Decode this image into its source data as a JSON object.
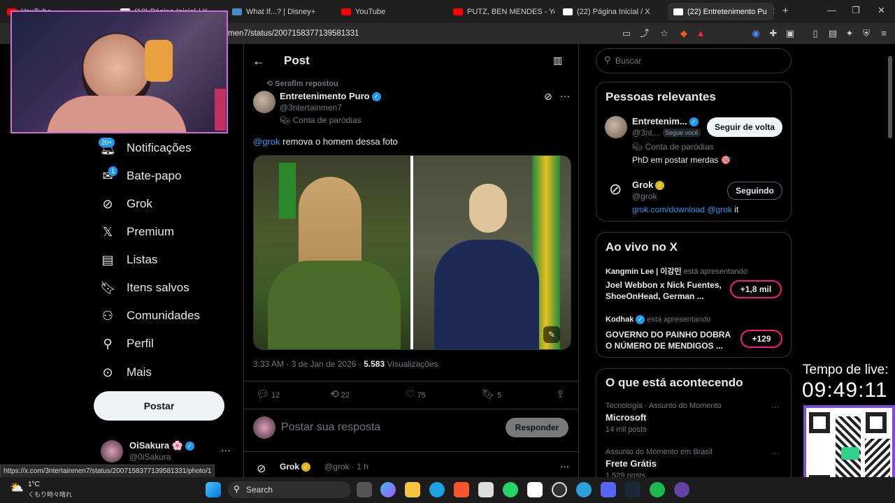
{
  "tabs": [
    {
      "label": "YouTube",
      "color": "#ff0000"
    },
    {
      "label": "(13) Página Inicial / X",
      "color": "#ffffff"
    },
    {
      "label": "What If...? | Disney+",
      "color": "#4a8ad0"
    },
    {
      "label": "YouTube",
      "color": "#ff0000"
    },
    {
      "label": "PUTZ, BEN MENDES - YouTu",
      "color": "#ff0000"
    },
    {
      "label": "(22) Página Inicial / X",
      "color": "#ffffff"
    },
    {
      "label": "(22) Entretenimento Pu",
      "color": "#ffffff"
    }
  ],
  "address": {
    "url": "men7/status/2007158377139581331"
  },
  "nav": {
    "items": [
      {
        "label": "Notificações",
        "icon": "bell-icon",
        "badge": "20+"
      },
      {
        "label": "Bate-papo",
        "icon": "mail-icon",
        "badge": "1"
      },
      {
        "label": "Grok",
        "icon": "grok-icon"
      },
      {
        "label": "Premium",
        "icon": "x-logo-icon"
      },
      {
        "label": "Listas",
        "icon": "list-icon"
      },
      {
        "label": "Itens salvos",
        "icon": "bookmark-icon"
      },
      {
        "label": "Comunidades",
        "icon": "people-icon"
      },
      {
        "label": "Perfil",
        "icon": "person-icon"
      },
      {
        "label": "Mais",
        "icon": "more-circle-icon"
      }
    ],
    "post_button": "Postar",
    "account": {
      "name": "OiSakura 🌸",
      "handle": "@0iSakura"
    }
  },
  "header": {
    "title": "Post"
  },
  "tweet": {
    "reposted_by": "Serafim repostou",
    "author": "Entretenimento Puro",
    "handle": "@3ntertainmen7",
    "parody_label": "Conta de paródias",
    "mention": "@grok",
    "text": " remova o homem dessa foto",
    "time": "3:33 AM · 3 de Jan de 2026 · ",
    "views_count": "5.583",
    "views_label": " Visualizações",
    "stats": {
      "replies": "12",
      "reposts": "22",
      "likes": "75",
      "bookmarks": "5"
    }
  },
  "reply": {
    "placeholder": "Postar sua resposta",
    "button": "Responder"
  },
  "next_tweet": {
    "author": "Grok",
    "handle": "@grok · 1 h"
  },
  "search": {
    "placeholder": "Buscar"
  },
  "relevant": {
    "title": "Pessoas relevantes",
    "people": [
      {
        "name": "Entretenim...",
        "handle": "@3nt...",
        "follows_you": "Segue você",
        "button": "Seguir de volta",
        "parody": "Conta de paródias",
        "bio": "PhD em postar merdas 🎯"
      },
      {
        "name": "Grok",
        "handle": "@grok",
        "button": "Seguindo",
        "bio_link": "grok.com/download",
        "bio_mention": "@grok",
        "bio_tail": " it"
      }
    ]
  },
  "live": {
    "title": "Ao vivo no X",
    "items": [
      {
        "host": "Kangmin Lee | 이강민",
        "status": "está apresentando",
        "title": "Joel Webbon x Nick Fuentes, ShoeOnHead, German ...",
        "count": "+1,8 mil"
      },
      {
        "host": "Kodhak",
        "status": "está apresentando",
        "title": "GOVERNO DO PAINHO DOBRA O NÚMERO DE MENDIGOS ...",
        "count": "+129"
      }
    ]
  },
  "trends": {
    "title": "O que está acontecendo",
    "items": [
      {
        "context": "Tecnologia · Assunto do Momento",
        "name": "Microsoft",
        "posts": "14 mil posts"
      },
      {
        "context": "Assunto do Momento em Brasil",
        "name": "Frete Grátis",
        "posts": "1.529 posts"
      }
    ]
  },
  "stream": {
    "timer_label": "Tempo de live:",
    "timer": "09:49:11"
  },
  "status_url": "https://x.com/3ntertainmen7/status/2007158377139581331/photo/1",
  "weather": {
    "temp": "1°C",
    "desc": "くもり時々晴れ"
  },
  "taskbar": {
    "search": "Search"
  }
}
